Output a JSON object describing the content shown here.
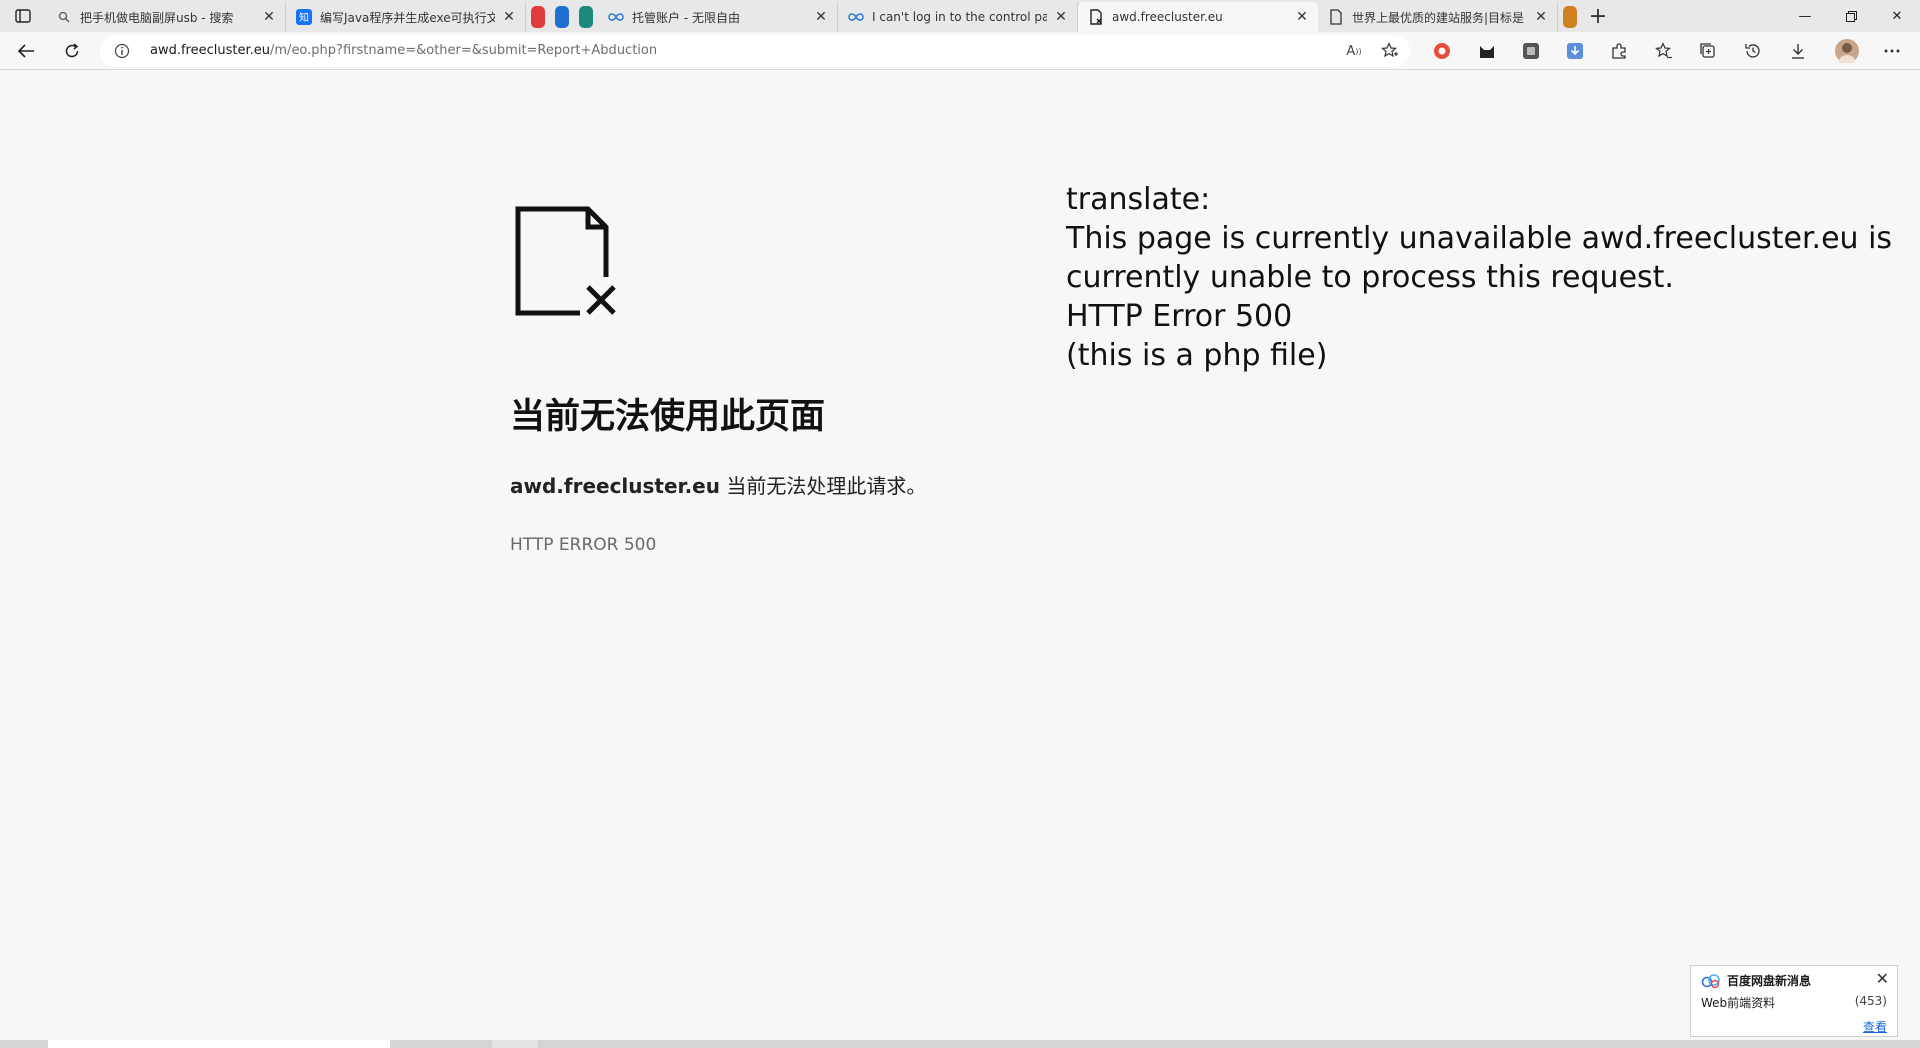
{
  "tabs": [
    {
      "title": "把手机做电脑副屏usb - 搜索",
      "icon": "search-icon"
    },
    {
      "title": "编写Java程序并生成exe可执行文件",
      "icon": "zhihu-icon"
    },
    {
      "title": "托管账户 - 无限自由",
      "icon": "infinity-icon"
    },
    {
      "title": "I can't log in to the control panel",
      "icon": "infinity-icon"
    },
    {
      "title": "awd.freecluster.eu",
      "icon": "broken-page-icon",
      "active": true
    },
    {
      "title": "世界上最优质的建站服务|目标是",
      "icon": "page-icon"
    }
  ],
  "pinned_tab_colors": [
    "#e03b3b",
    "#1e6fd0",
    "#1a8a7a",
    "#d08020"
  ],
  "address": {
    "host": "awd.freecluster.eu",
    "path": "/m/eo.php?firstname=&other=&submit=Report+Abduction"
  },
  "error": {
    "heading": "当前无法使用此页面",
    "desc_host": "awd.freecluster.eu",
    "desc_text": " 当前无法处理此请求。",
    "code": "HTTP ERROR 500"
  },
  "translate": {
    "lines": [
      "translate:",
      "This page is currently unavailable awd.freecluster.eu is",
      "currently unable to process this request.",
      "HTTP Error 500",
      "(this is a php file)"
    ]
  },
  "notification": {
    "title": "百度网盘新消息",
    "folder": "Web前端资料",
    "count": "(453)",
    "link": "查看"
  }
}
